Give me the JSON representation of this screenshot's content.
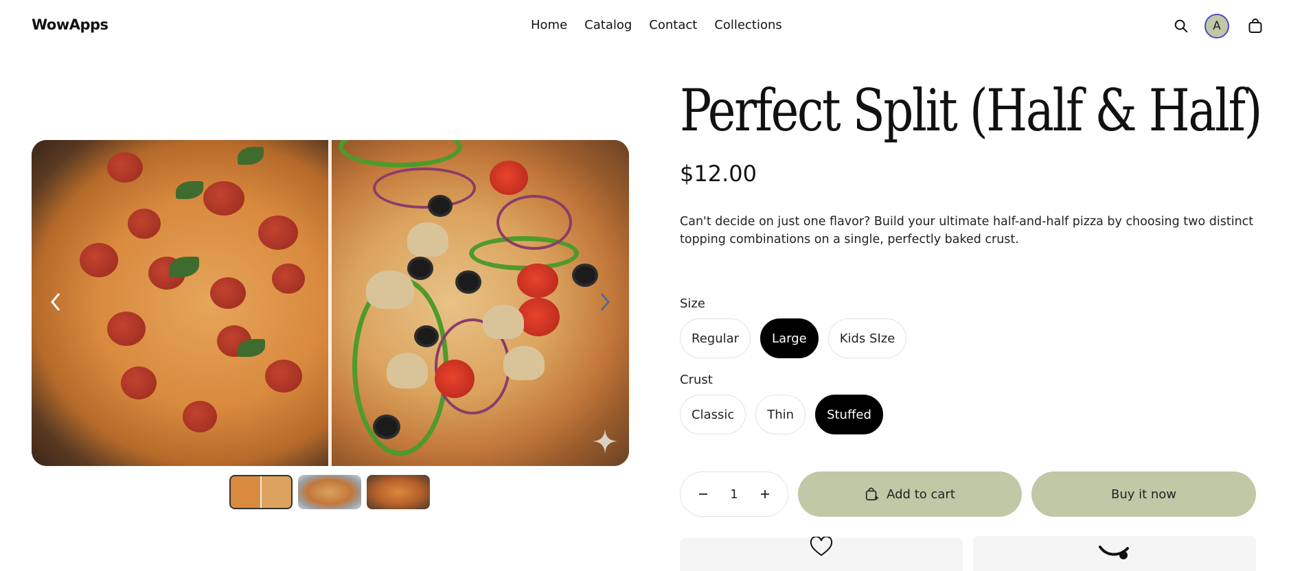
{
  "header": {
    "brand": "WowApps",
    "nav": [
      "Home",
      "Catalog",
      "Contact",
      "Collections"
    ],
    "avatar_initial": "A",
    "icons": [
      "search-icon",
      "bag-icon"
    ]
  },
  "gallery": {
    "thumbnails": 3,
    "active_thumbnail": 1,
    "icons": [
      "chevron-left-icon",
      "chevron-right-icon",
      "sparkle-icon"
    ]
  },
  "product": {
    "title": "Perfect Split (Half & Half)",
    "price": "$12.00",
    "description": "Can't decide on just one flavor? Build your ultimate half-and-half pizza by choosing two distinct topping combinations on a single, perfectly baked crust.",
    "size": {
      "label": "Size",
      "options": [
        "Regular",
        "Large",
        "Kids SIze"
      ],
      "selected": "Large"
    },
    "crust": {
      "label": "Crust",
      "options": [
        "Classic",
        "Thin",
        "Stuffed"
      ],
      "selected": "Stuffed"
    },
    "quantity": "1",
    "add_to_cart": "Add to cart",
    "buy_now": "Buy it now"
  },
  "colors": {
    "accent_button": "#c0c8a6",
    "selected_pill": "#000000",
    "avatar_border": "#4c4acb"
  }
}
